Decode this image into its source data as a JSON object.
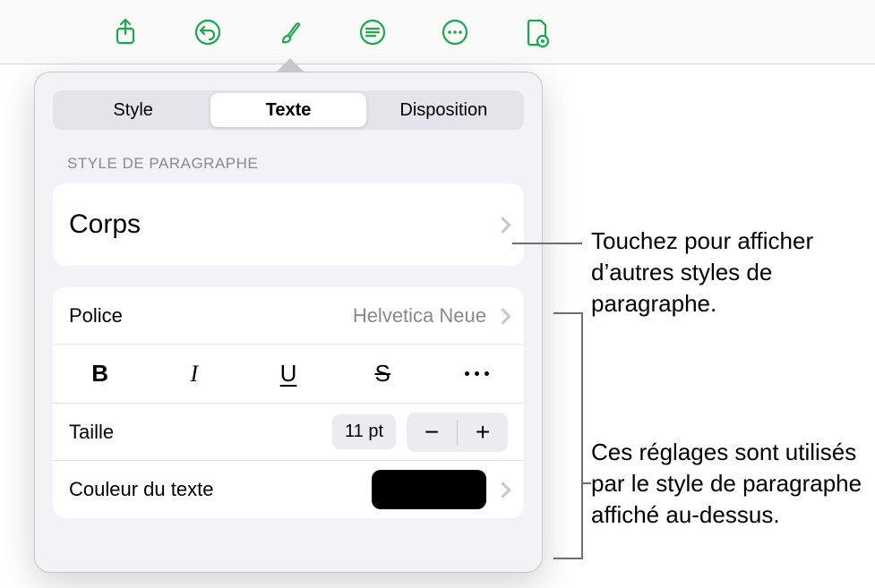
{
  "toolbar": {
    "share_icon": "share-icon",
    "undo_icon": "undo-icon",
    "format_icon": "format-brush-icon",
    "insert_icon": "insert-icon",
    "more_icon": "more-circle-icon",
    "collab_icon": "document-badge-icon"
  },
  "tabs": {
    "style": "Style",
    "text": "Texte",
    "layout": "Disposition"
  },
  "paragraph_style": {
    "section_label": "STYLE DE PARAGRAPHE",
    "current": "Corps"
  },
  "font": {
    "label": "Police",
    "value": "Helvetica Neue"
  },
  "text_format": {
    "bold": "B",
    "italic": "I",
    "underline": "U",
    "strike": "S"
  },
  "size": {
    "label": "Taille",
    "value": "11 pt"
  },
  "text_color": {
    "label": "Couleur du texte",
    "value_hex": "#000000"
  },
  "callouts": {
    "paragraph": "Touchez pour afficher d’autres styles de paragraphe.",
    "settings": "Ces réglages sont utilisés par le style de paragraphe affiché au-dessus."
  }
}
